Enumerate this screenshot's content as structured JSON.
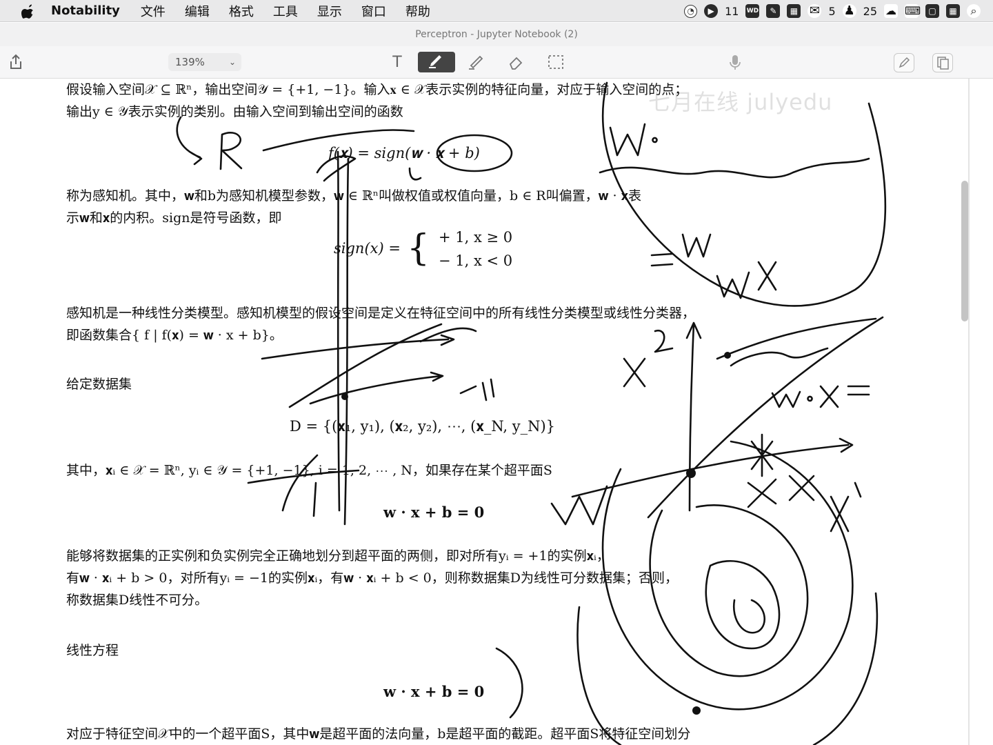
{
  "menubar": {
    "app_name": "Notability",
    "items": [
      "文件",
      "编辑",
      "格式",
      "工具",
      "显示",
      "窗口",
      "帮助"
    ],
    "status": {
      "badge_a": "11",
      "wechat_count": "5",
      "notif_count": "25"
    }
  },
  "window": {
    "title": "Perceptron - Jupyter Notebook (2)"
  },
  "toolbar": {
    "zoom": "139%",
    "text_tool_glyph": "T",
    "watermark": "七月在线 julyedu"
  },
  "document": {
    "p1_line1": "假设输入空间𝒳 ⊆ ℝⁿ，输出空间𝒴 = {+1, −1}。输入𝐱 ∈ 𝒳表示实例的特征向量，对应于输入空间的点；",
    "p1_line2": "输出y ∈ 𝒴表示实例的类别。由输入空间到输出空间的函数",
    "eq1": "f(𝐱) = sign(𝐰 · 𝐱 + b)",
    "p2_line1": "称为感知机。其中，𝐰和b为感知机模型参数，𝐰 ∈ ℝⁿ叫做权值或权值向量，b ∈ R叫偏置，𝐰 · 𝐱表",
    "p2_line2": "示𝐰和𝐱的内积。sign是符号函数，即",
    "eq2_lhs": "sign(x) =",
    "eq2_case1": "+ 1, x ≥ 0",
    "eq2_case2": "− 1, x < 0",
    "p3_line1": "感知机是一种线性分类模型。感知机模型的假设空间是定义在特征空间中的所有线性分类模型或线性分类器，",
    "p3_line2": "即函数集合{ f | f(𝐱) = 𝐰 · x + b}。",
    "h_dataset": "给定数据集",
    "eq3": "D = {(𝐱₁, y₁), (𝐱₂, y₂), ⋯, (𝐱_N, y_N)}",
    "p4": "其中，𝐱ᵢ ∈ 𝒳 = ℝⁿ, yᵢ ∈ 𝒴 = {+1, −1}, i = 1, 2, ⋯ , N，如果存在某个超平面S",
    "eq4": "𝐰 · 𝐱 + b = 0",
    "p5_line1": "能够将数据集的正实例和负实例完全正确地划分到超平面的两侧，即对所有yᵢ = +1的实例𝐱ᵢ，",
    "p5_line2": "有𝐰 · 𝐱ᵢ + b > 0，对所有yᵢ = −1的实例𝐱ᵢ，有𝐰 · 𝐱ᵢ + b < 0，则称数据集D为线性可分数据集；否则，",
    "p5_line3": "称数据集D线性不可分。",
    "h_linear": "线性方程",
    "eq5": "𝐰 · 𝐱 + b = 0",
    "p6": "对应于特征空间𝒳中的一个超平面S，其中𝐰是超平面的法向量，b是超平面的截距。超平面S将特征空间划分"
  },
  "colors": {
    "ink": "#111111",
    "menubar_bg": "#e9e9ea",
    "active_tool": "#444444"
  }
}
